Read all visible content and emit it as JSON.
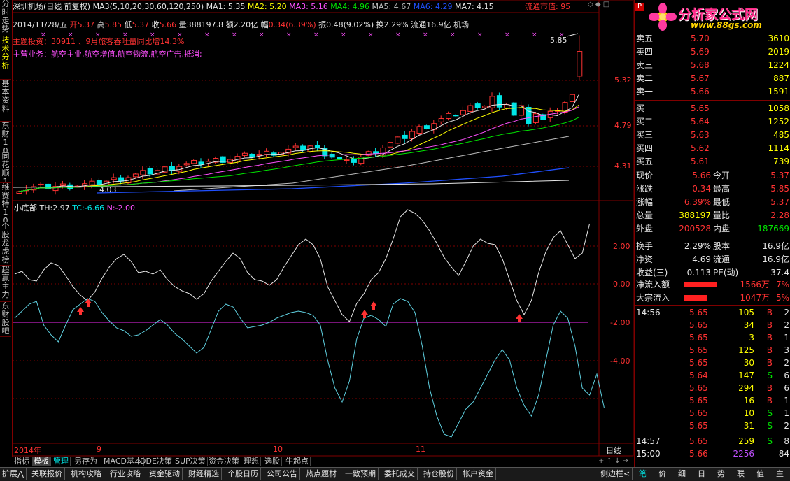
{
  "left_tabs": [
    "分时走势",
    "技术分析",
    "基本资料",
    "东财10",
    "同花顺10",
    "维赛特10",
    "个股龙虎榜",
    "超赢主力",
    "东财股吧"
  ],
  "header": {
    "stock_name": "深圳机场(日线 前复权)",
    "ma_label": "MA3(5,10,20,30,60,120,250)",
    "ma_values": [
      {
        "label": "MA1:",
        "value": "5.35",
        "color": "#e6e6e6"
      },
      {
        "label": "MA2:",
        "value": "5.20",
        "color": "#ffff00"
      },
      {
        "label": "MA3:",
        "value": "5.16",
        "color": "#ff50ff"
      },
      {
        "label": "MA4:",
        "value": "4.96",
        "color": "#00e600"
      },
      {
        "label": "MA5:",
        "value": "4.67",
        "color": "#c0c0c0"
      },
      {
        "label": "MA6:",
        "value": "4.29",
        "color": "#2050ff"
      },
      {
        "label": "MA7:",
        "value": "4.15",
        "color": "#e6e6e6"
      }
    ],
    "float_value_label": "流通市值: 95",
    "controls": "◇ ◆ □"
  },
  "quote_line": {
    "date": "2014/11/28/五",
    "open_label": "开",
    "open": "5.37",
    "high_label": "高",
    "high": "5.85",
    "low_label": "低",
    "low": "5.37",
    "close_label": "收",
    "close": "5.66",
    "volume_label": "量",
    "volume": "388197.8",
    "amount_label": "额",
    "amount": "2.20亿",
    "change_label": "幅",
    "change": "0.34(6.39%)",
    "amplitude_label": "振",
    "amplitude": "0.48(9.02%)",
    "turnover_label": "换",
    "turnover": "2.29%",
    "float_label": "流通",
    "float": "16.9亿",
    "sector": "机场"
  },
  "notes": {
    "investment": "主题投资：30911 、9月旅客吞吐量同比增14.3%",
    "business": "主营业务：航空主业,航空增值,航空物流,航空广告,抵消;"
  },
  "price_axis": [
    "5.32",
    "4.79",
    "4.31"
  ],
  "price_marks": {
    "high": "5.85",
    "low": "4.03"
  },
  "indicator": {
    "name": "小底部",
    "th_label": "TH:",
    "th": "2.97",
    "tc_label": "TC:",
    "tc": "-6.66",
    "n_label": "N:",
    "n": "-2.00",
    "axis": [
      "2.00",
      "0.00",
      "-2.00",
      "-4.00"
    ]
  },
  "time_axis": {
    "year": "2014年",
    "m1": "9",
    "m2": "10",
    "m3": "11",
    "period": "日线"
  },
  "bottom_tabs": [
    "指标",
    "模板",
    "管理",
    "另存为",
    "MACD基本",
    "DDE决策",
    "SUP决策",
    "资金决策",
    "理想",
    "选股",
    "牛起点"
  ],
  "status_tabs": [
    "扩展⋀",
    "关联报价",
    "机构攻略",
    "行业攻略",
    "资金驱动",
    "财经精选",
    "个股日历",
    "公司公告",
    "热点题材",
    "一致预期",
    "委托成交",
    "持仓股份",
    "帐户资金",
    "侧边栏<"
  ],
  "status_right": [
    "笔",
    "价",
    "细",
    "日",
    "势",
    "联",
    "值",
    "主"
  ],
  "logo": {
    "title": "分析家公式网",
    "url": "www.88gs.com"
  },
  "orderbook": {
    "sell": [
      {
        "label": "卖五",
        "price": "5.70",
        "vol": "3610"
      },
      {
        "label": "卖四",
        "price": "5.69",
        "vol": "2019"
      },
      {
        "label": "卖三",
        "price": "5.68",
        "vol": "1224"
      },
      {
        "label": "卖二",
        "price": "5.67",
        "vol": "887"
      },
      {
        "label": "卖一",
        "price": "5.66",
        "vol": "1591"
      }
    ],
    "buy": [
      {
        "label": "买一",
        "price": "5.65",
        "vol": "1058"
      },
      {
        "label": "买二",
        "price": "5.64",
        "vol": "1252"
      },
      {
        "label": "买三",
        "price": "5.63",
        "vol": "485"
      },
      {
        "label": "买四",
        "price": "5.62",
        "vol": "1114"
      },
      {
        "label": "买五",
        "price": "5.61",
        "vol": "739"
      }
    ]
  },
  "stats": [
    {
      "l1": "现价",
      "v1": "5.66",
      "c1": "#ff3232",
      "l2": "今开",
      "v2": "5.37",
      "c2": "#ff3232"
    },
    {
      "l1": "涨跌",
      "v1": "0.34",
      "c1": "#ff3232",
      "l2": "最高",
      "v2": "5.85",
      "c2": "#ff3232"
    },
    {
      "l1": "涨幅",
      "v1": "6.39%",
      "c1": "#ff3232",
      "l2": "最低",
      "v2": "5.37",
      "c2": "#ff3232"
    },
    {
      "l1": "总量",
      "v1": "388197",
      "c1": "#ffff00",
      "l2": "量比",
      "v2": "2.28",
      "c2": "#ff3232"
    },
    {
      "l1": "外盘",
      "v1": "200528",
      "c1": "#ff3232",
      "l2": "内盘",
      "v2": "187669",
      "c2": "#00e600"
    },
    {
      "l1": "换手",
      "v1": "2.29%",
      "c1": "#e6e6e6",
      "l2": "股本",
      "v2": "16.9亿",
      "c2": "#e6e6e6"
    },
    {
      "l1": "净资",
      "v1": "4.69",
      "c1": "#e6e6e6",
      "l2": "流通",
      "v2": "16.9亿",
      "c2": "#e6e6e6"
    },
    {
      "l1": "收益(三)",
      "v1": "0.113",
      "c1": "#e6e6e6",
      "l2": "PE(动)",
      "v2": "37.4",
      "c2": "#e6e6e6"
    }
  ],
  "flows": [
    {
      "label": "净流入额",
      "value": "1566万",
      "pct": "7%"
    },
    {
      "label": "大宗流入",
      "value": "1047万",
      "pct": "5%"
    }
  ],
  "ticks": [
    {
      "time": "14:56",
      "price": "5.65",
      "vol": "105",
      "side": "B",
      "n": "2"
    },
    {
      "time": "",
      "price": "5.65",
      "vol": "34",
      "side": "B",
      "n": "2"
    },
    {
      "time": "",
      "price": "5.65",
      "vol": "3",
      "side": "B",
      "n": "1"
    },
    {
      "time": "",
      "price": "5.65",
      "vol": "125",
      "side": "B",
      "n": "3"
    },
    {
      "time": "",
      "price": "5.65",
      "vol": "30",
      "side": "B",
      "n": "2"
    },
    {
      "time": "",
      "price": "5.64",
      "vol": "147",
      "side": "S",
      "n": "6"
    },
    {
      "time": "",
      "price": "5.65",
      "vol": "294",
      "side": "B",
      "n": "6"
    },
    {
      "time": "",
      "price": "5.65",
      "vol": "16",
      "side": "B",
      "n": "1"
    },
    {
      "time": "",
      "price": "5.65",
      "vol": "10",
      "side": "S",
      "n": "1"
    },
    {
      "time": "",
      "price": "5.65",
      "vol": "31",
      "side": "S",
      "n": "2"
    },
    {
      "time": "14:57",
      "price": "5.65",
      "vol": "259",
      "side": "S",
      "n": "8"
    },
    {
      "time": "15:00",
      "price": "5.66",
      "vol": "2256",
      "side": "",
      "n": "84"
    }
  ],
  "colors": {
    "up": "#ff3232",
    "down": "#00e6e6",
    "frame": "#800000"
  }
}
